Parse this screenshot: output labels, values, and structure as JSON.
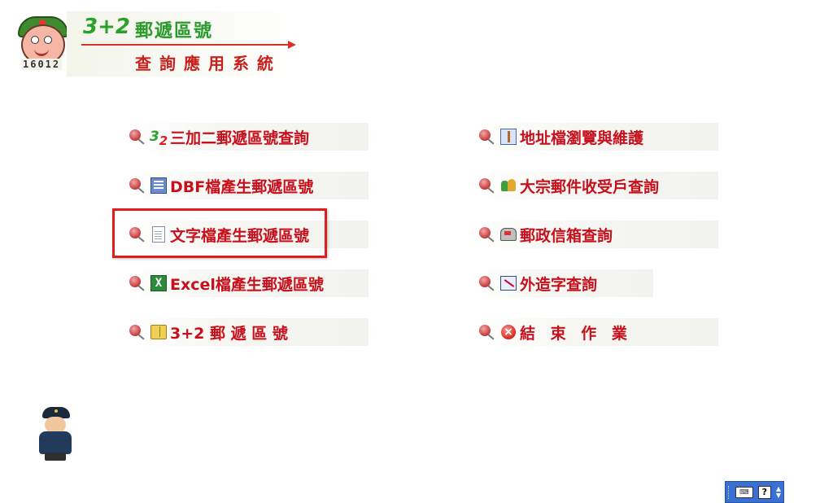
{
  "banner": {
    "mascot_code": "16012",
    "prefix": "3+2",
    "title": "郵遞區號",
    "subtitle": "查詢應用系統"
  },
  "menu": {
    "left": [
      {
        "label": "三加二郵遞區號查詢",
        "icon": "three-plus-two-icon",
        "icon_text_a": "3",
        "icon_text_b": "2"
      },
      {
        "label": "DBF檔產生郵遞區號",
        "icon": "database-icon"
      },
      {
        "label": "文字檔產生郵遞區號",
        "icon": "text-file-icon"
      },
      {
        "label": "Excel檔產生郵遞區號",
        "icon": "excel-icon",
        "icon_text": "X"
      },
      {
        "label": "3+2 郵 遞 區 號",
        "icon": "book-icon"
      }
    ],
    "right": [
      {
        "label": "地址檔瀏覽與維護",
        "icon": "address-tool-icon"
      },
      {
        "label": "大宗郵件收受戶查詢",
        "icon": "people-icon"
      },
      {
        "label": "郵政信箱查詢",
        "icon": "mailbox-icon"
      },
      {
        "label": "外造字查詢",
        "icon": "custom-char-icon"
      },
      {
        "label": "結 束 作 業",
        "icon": "exit-icon",
        "icon_text": "×"
      }
    ],
    "selected_label": "文字檔產生郵遞區號"
  },
  "ime_toolbar": {
    "keyboard_label": "⌨",
    "help_label": "?"
  },
  "colors": {
    "label": "#c8101c",
    "highlight": "#e01c1c",
    "banner_green": "#2a9a2a",
    "ime_blue": "#3a6fd4"
  }
}
